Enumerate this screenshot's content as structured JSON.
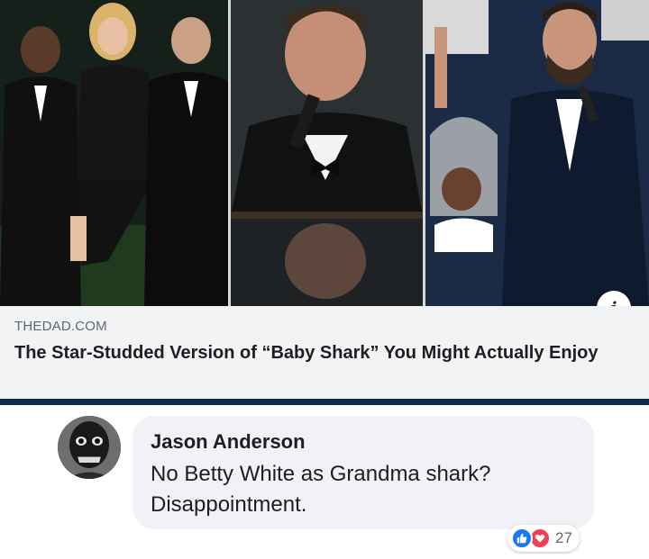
{
  "link_preview": {
    "domain": "THEDAD.COM",
    "title": "The Star-Studded Version of “Baby Shark” You Might Actually Enjoy",
    "info_icon": "info-icon",
    "images": [
      "photo-three-people-formal",
      "photo-singer-piano",
      "photo-singer-sharks-chorus"
    ]
  },
  "comment": {
    "author": "Jason Anderson",
    "text": "No Betty White as Grandma shark? Disappointment.",
    "reaction_count": "27",
    "reaction_icons": [
      "like-icon",
      "love-icon"
    ],
    "colors": {
      "like": "#1877f2",
      "love": "#f33e58",
      "bubble": "#f0f2f5",
      "rule": "#0b2b4f"
    }
  }
}
